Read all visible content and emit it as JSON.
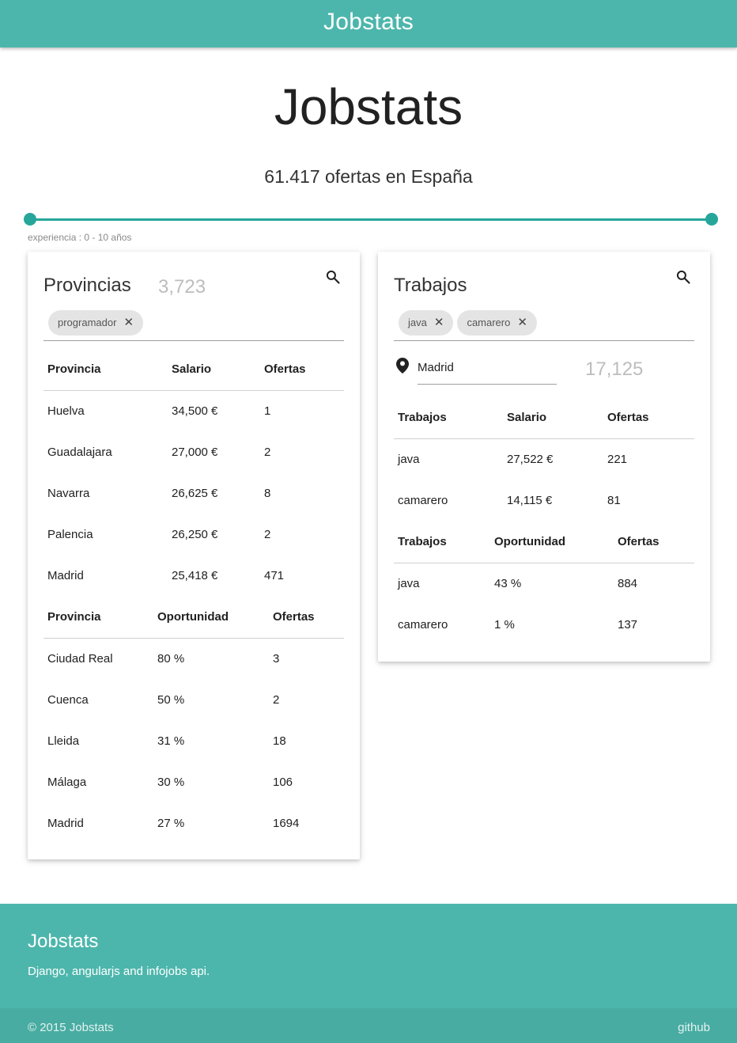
{
  "navbar": {
    "brand": "Jobstats"
  },
  "hero": {
    "title": "Jobstats",
    "subtitle": "61.417 ofertas en España"
  },
  "slider": {
    "label": "experiencia : 0 - 10 años",
    "range": [
      0,
      10
    ]
  },
  "provincias_card": {
    "title": "Provincias",
    "count": "3,723",
    "chips": [
      "programador"
    ],
    "salary_table": {
      "headers": [
        "Provincia",
        "Salario",
        "Ofertas"
      ],
      "rows": [
        [
          "Huelva",
          "34,500 €",
          "1"
        ],
        [
          "Guadalajara",
          "27,000 €",
          "2"
        ],
        [
          "Navarra",
          "26,625 €",
          "8"
        ],
        [
          "Palencia",
          "26,250 €",
          "2"
        ],
        [
          "Madrid",
          "25,418 €",
          "471"
        ]
      ]
    },
    "opportunity_table": {
      "headers": [
        "Provincia",
        "Oportunidad",
        "Ofertas"
      ],
      "rows": [
        [
          "Ciudad Real",
          "80 %",
          "3"
        ],
        [
          "Cuenca",
          "50 %",
          "2"
        ],
        [
          "Lleida",
          "31 %",
          "18"
        ],
        [
          "Málaga",
          "30 %",
          "106"
        ],
        [
          "Madrid",
          "27 %",
          "1694"
        ]
      ]
    }
  },
  "trabajos_card": {
    "title": "Trabajos",
    "chips": [
      "java",
      "camarero"
    ],
    "location": "Madrid",
    "count": "17,125",
    "salary_table": {
      "headers": [
        "Trabajos",
        "Salario",
        "Ofertas"
      ],
      "rows": [
        [
          "java",
          "27,522 €",
          "221"
        ],
        [
          "camarero",
          "14,115 €",
          "81"
        ]
      ]
    },
    "opportunity_table": {
      "headers": [
        "Trabajos",
        "Oportunidad",
        "Ofertas"
      ],
      "rows": [
        [
          "java",
          "43 %",
          "884"
        ],
        [
          "camarero",
          "1 %",
          "137"
        ]
      ]
    }
  },
  "footer": {
    "title": "Jobstats",
    "description": "Django, angularjs and infojobs api.",
    "copyright": "© 2015 Jobstats",
    "github_link": "github"
  },
  "colors": {
    "accent": "#4db6ac",
    "slider": "#26a69a"
  }
}
